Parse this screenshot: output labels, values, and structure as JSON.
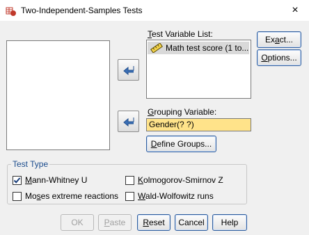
{
  "window": {
    "title": "Two-Independent-Samples Tests",
    "close_icon": "×"
  },
  "source_list": {
    "items": []
  },
  "test_variable": {
    "label_pre": "",
    "label_u": "T",
    "label_post": "est Variable List:",
    "items": [
      {
        "icon": "ruler-icon",
        "text": "Math test score (1 to..."
      }
    ]
  },
  "grouping": {
    "label_pre": "",
    "label_u": "G",
    "label_post": "rouping Variable:",
    "value": "Gender(? ?)",
    "define_pre": "",
    "define_u": "D",
    "define_post": "efine Groups..."
  },
  "side_buttons": {
    "exact_pre": "Ex",
    "exact_u": "a",
    "exact_post": "ct...",
    "options_pre": "",
    "options_u": "O",
    "options_post": "ptions..."
  },
  "test_type": {
    "legend": "Test Type",
    "options": [
      {
        "pre": "",
        "u": "M",
        "post": "ann-Whitney U",
        "checked": true
      },
      {
        "pre": "",
        "u": "K",
        "post": "olmogorov-Smirnov Z",
        "checked": false
      },
      {
        "pre": "Mo",
        "u": "s",
        "post": "es extreme reactions",
        "checked": false
      },
      {
        "pre": "",
        "u": "W",
        "post": "ald-Wolfowitz runs",
        "checked": false
      }
    ]
  },
  "bottom_buttons": {
    "ok": "OK",
    "paste_pre": "",
    "paste_u": "P",
    "paste_post": "aste",
    "reset_pre": "",
    "reset_u": "R",
    "reset_post": "eset",
    "cancel": "Cancel",
    "help": "Help"
  },
  "colors": {
    "arrow": "#3a6fb5",
    "grouping_bg": "#ffe38a",
    "accent": "#1a4b8c"
  }
}
